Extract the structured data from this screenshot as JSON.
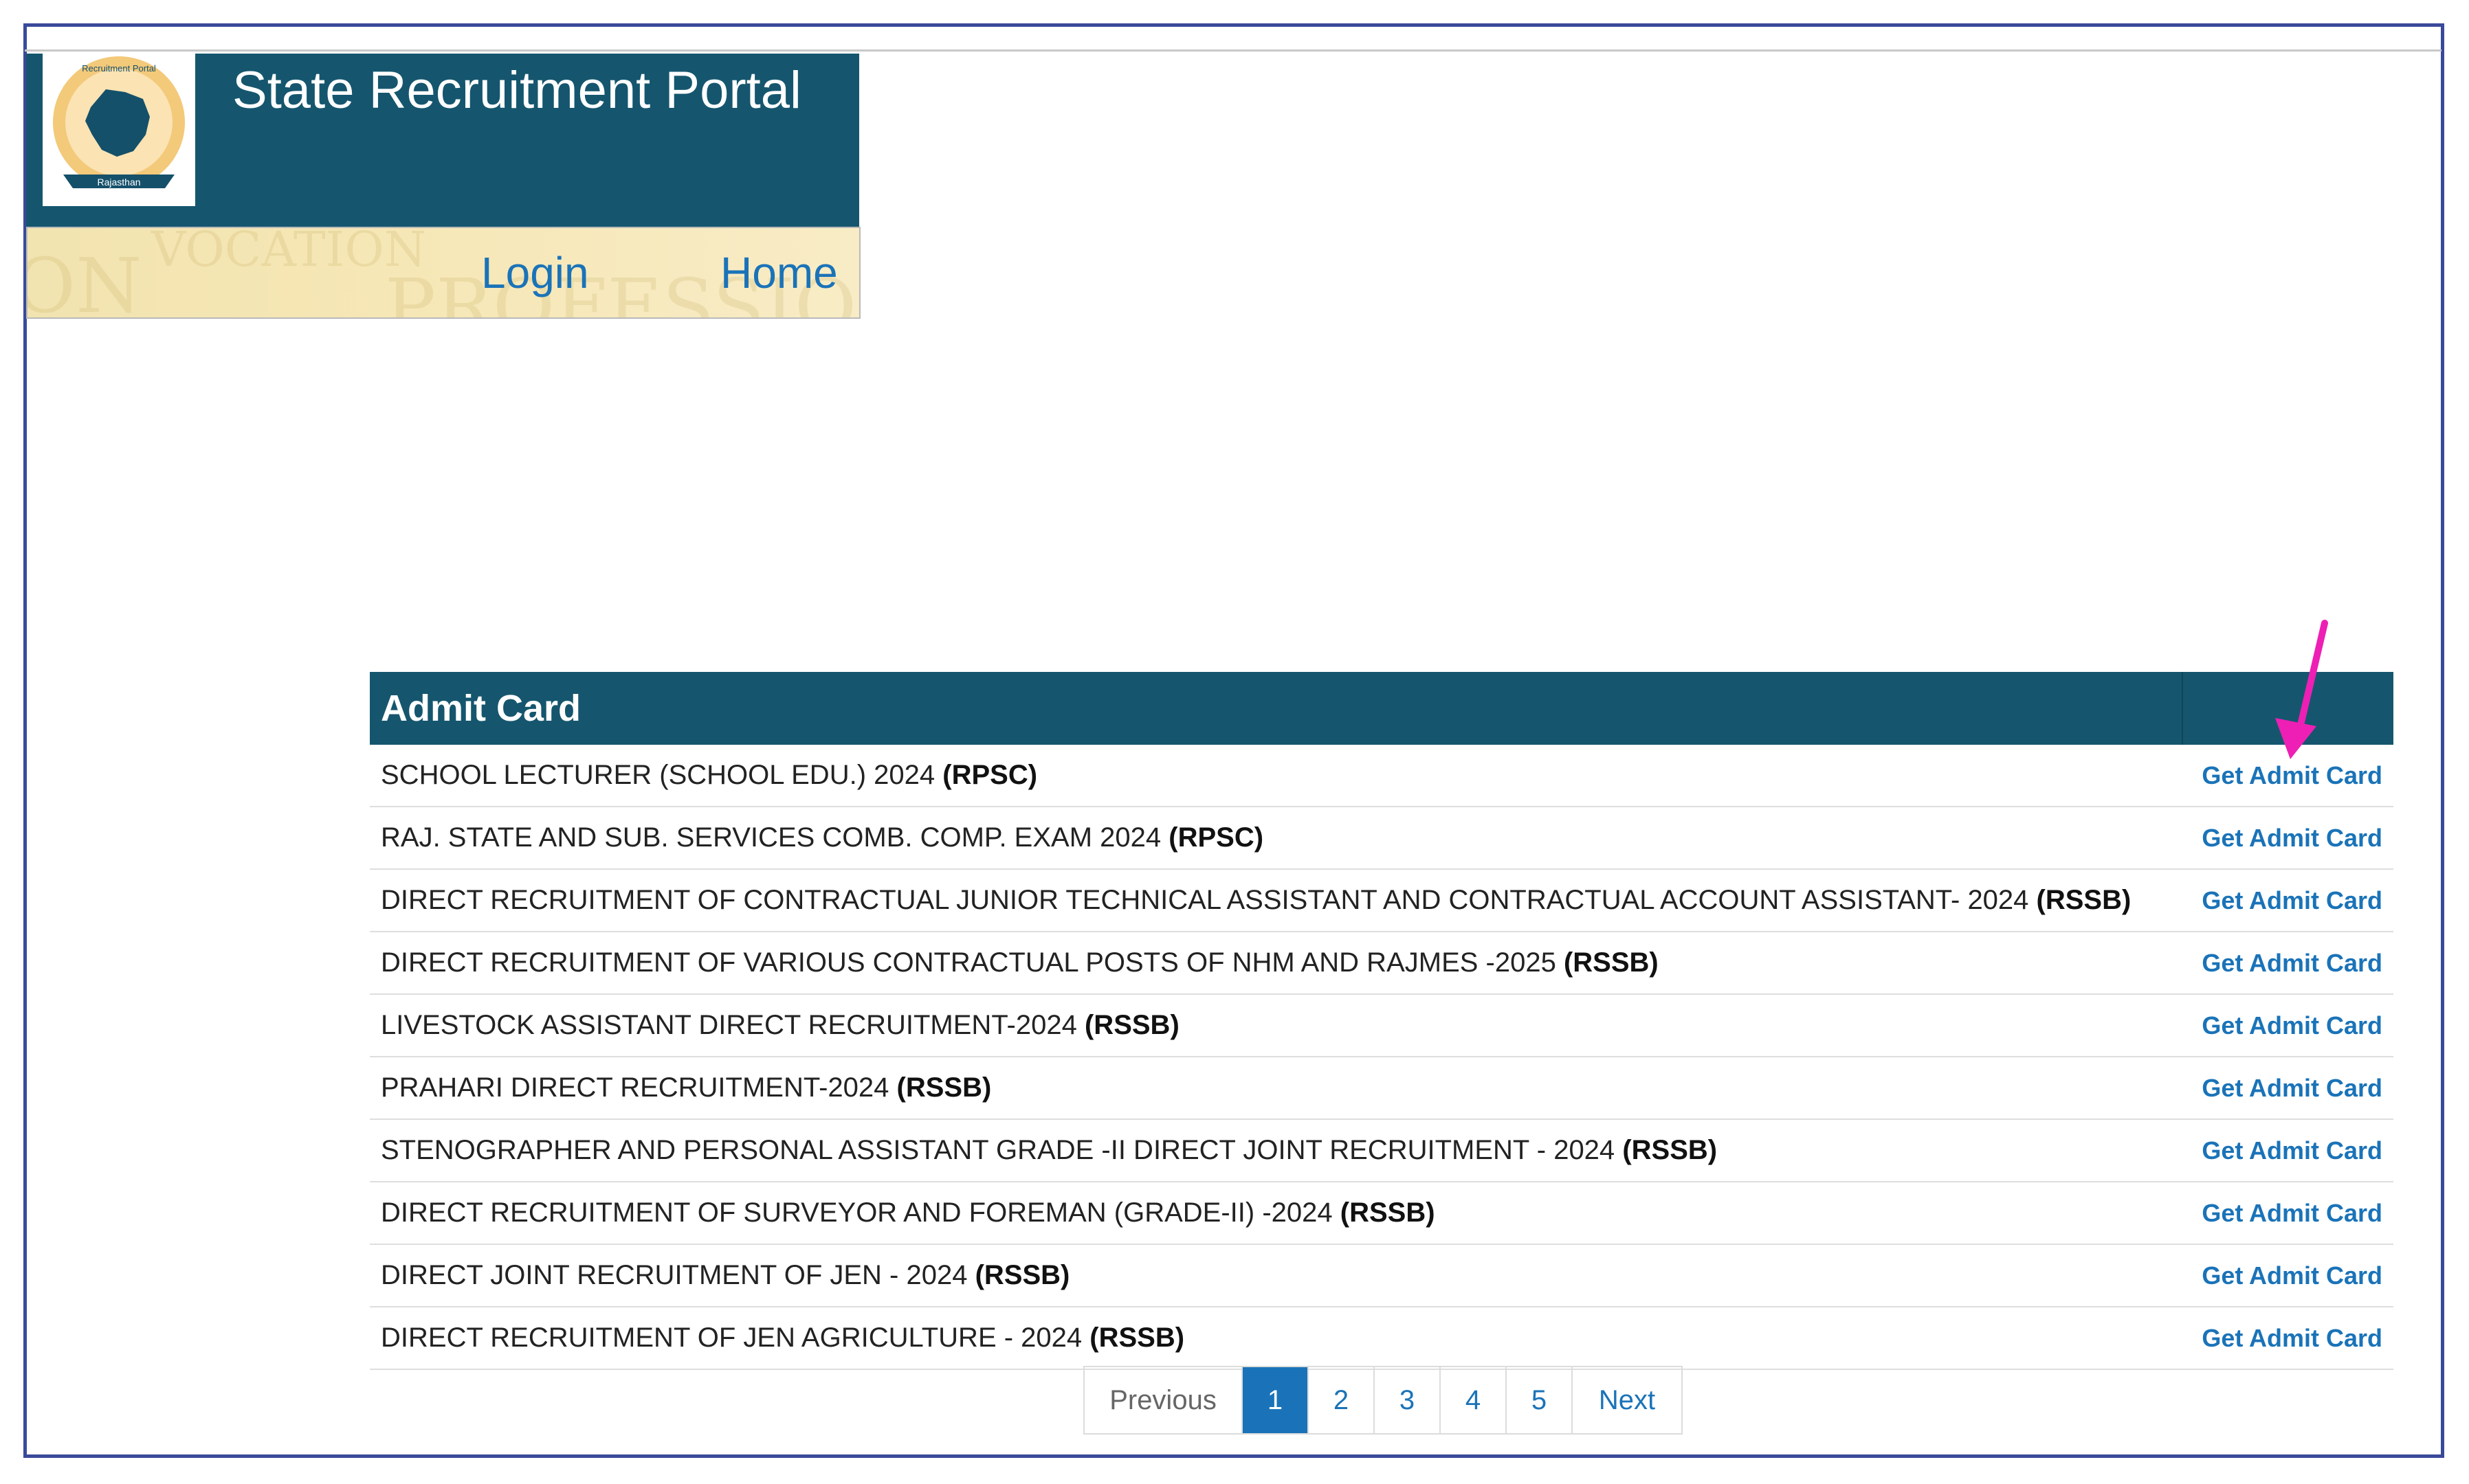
{
  "header": {
    "title": "State Recruitment Portal",
    "logo_icon": "state-map-emblem-icon",
    "logo_ring_text": "Recruitment Portal",
    "logo_banner_text": "Rajasthan"
  },
  "nav": {
    "login": "Login",
    "home": "Home"
  },
  "admit_card": {
    "title": "Admit Card",
    "rows": [
      {
        "name": "SCHOOL LECTURER (SCHOOL EDU.) 2024",
        "board": "(RPSC)",
        "action": "Get Admit Card"
      },
      {
        "name": "RAJ. STATE AND SUB. SERVICES COMB. COMP. EXAM 2024",
        "board": "(RPSC)",
        "action": "Get Admit Card"
      },
      {
        "name": "DIRECT RECRUITMENT OF CONTRACTUAL JUNIOR TECHNICAL ASSISTANT AND CONTRACTUAL ACCOUNT ASSISTANT- 2024",
        "board": "(RSSB)",
        "action": "Get Admit Card"
      },
      {
        "name": "DIRECT RECRUITMENT OF VARIOUS CONTRACTUAL POSTS OF NHM AND RAJMES -2025",
        "board": "(RSSB)",
        "action": "Get Admit Card"
      },
      {
        "name": "LIVESTOCK ASSISTANT DIRECT RECRUITMENT-2024",
        "board": "(RSSB)",
        "action": "Get Admit Card"
      },
      {
        "name": "PRAHARI DIRECT RECRUITMENT-2024",
        "board": "(RSSB)",
        "action": "Get Admit Card"
      },
      {
        "name": "STENOGRAPHER AND PERSONAL ASSISTANT GRADE -II DIRECT JOINT RECRUITMENT - 2024",
        "board": "(RSSB)",
        "action": "Get Admit Card"
      },
      {
        "name": "DIRECT RECRUITMENT OF SURVEYOR AND FOREMAN (GRADE-II) -2024",
        "board": "(RSSB)",
        "action": "Get Admit Card"
      },
      {
        "name": "DIRECT JOINT RECRUITMENT OF JEN - 2024",
        "board": "(RSSB)",
        "action": "Get Admit Card"
      },
      {
        "name": "DIRECT RECRUITMENT OF JEN AGRICULTURE - 2024",
        "board": "(RSSB)",
        "action": "Get Admit Card"
      }
    ]
  },
  "pagination": {
    "previous": "Previous",
    "pages": [
      "1",
      "2",
      "3",
      "4",
      "5"
    ],
    "active": "1",
    "next": "Next"
  },
  "colors": {
    "header_bg": "#15566e",
    "link": "#1a73b8",
    "annotation_arrow": "#ee1fb4",
    "frame_border": "#3a4a9a"
  },
  "annotation": {
    "icon": "pink-arrow-icon"
  }
}
